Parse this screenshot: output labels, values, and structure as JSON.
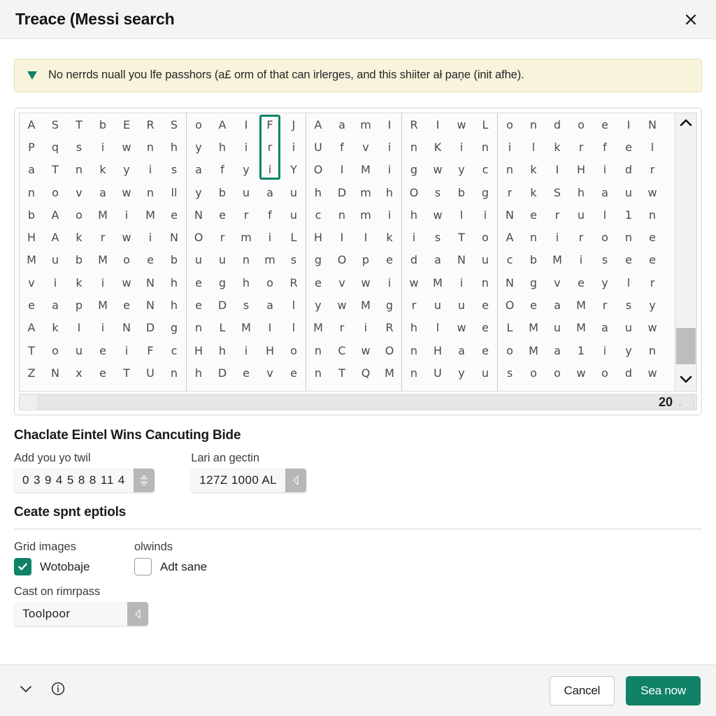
{
  "window": {
    "title": "Treace (Messi search",
    "close_icon": "close-icon"
  },
  "banner": {
    "icon": "triangle-down-icon",
    "accent_color": "#0f8267",
    "background_color": "#f8f4dc",
    "text": "No nerrds nuall you lfe passhors (a£ orm of that can irlerges, and this shiiter ał paņe (init afhe)."
  },
  "grid": {
    "blocks": [
      {
        "columns": 7,
        "rows": [
          [
            "A",
            "S",
            "T",
            "b",
            "E",
            "R",
            "S"
          ],
          [
            "P",
            "q",
            "s",
            "i",
            "w",
            "n",
            "h"
          ],
          [
            "a",
            "T",
            "n",
            "k",
            "y",
            "i",
            "s"
          ],
          [
            "n",
            "o",
            "v",
            "a",
            "w",
            "n",
            "ll"
          ],
          [
            "b",
            "A",
            "o",
            "M",
            "i",
            "M",
            "e"
          ],
          [
            "H",
            "A",
            "k",
            "r",
            "w",
            "i",
            "N"
          ],
          [
            "M",
            "u",
            "b",
            "M",
            "o",
            "e",
            "b"
          ],
          [
            "v",
            "i",
            "k",
            "i",
            "w",
            "N",
            "h"
          ],
          [
            "e",
            "a",
            "p",
            "M",
            "e",
            "N",
            "h"
          ],
          [
            "A",
            "k",
            "I",
            "i",
            "N",
            "D",
            "g"
          ],
          [
            "T",
            "o",
            "u",
            "e",
            "i",
            "F",
            "c"
          ],
          [
            "Z",
            "N",
            "x",
            "e",
            "T",
            "U",
            "n"
          ]
        ]
      },
      {
        "columns": 5,
        "rows": [
          [
            "o",
            "A",
            "I",
            "F",
            "J"
          ],
          [
            "y",
            "h",
            "i",
            "r",
            "i"
          ],
          [
            "a",
            "f",
            "y",
            "i",
            "Y"
          ],
          [
            "y",
            "b",
            "u",
            "a",
            "u"
          ],
          [
            "N",
            "e",
            "r",
            "f",
            "u"
          ],
          [
            "O",
            "r",
            "m",
            "i",
            "L"
          ],
          [
            "u",
            "u",
            "n",
            "m",
            "s"
          ],
          [
            "e",
            "g",
            "h",
            "o",
            "R"
          ],
          [
            "e",
            "D",
            "s",
            "a",
            "l"
          ],
          [
            "n",
            "L",
            "M",
            "I",
            "l"
          ],
          [
            "H",
            "h",
            "i",
            "H",
            "o"
          ],
          [
            "h",
            "D",
            "e",
            "v",
            "e"
          ]
        ]
      },
      {
        "columns": 4,
        "rows": [
          [
            "A",
            "a",
            "m",
            "I"
          ],
          [
            "U",
            "f",
            "v",
            "i"
          ],
          [
            "O",
            "I",
            "M",
            "i"
          ],
          [
            "h",
            "D",
            "m",
            "h"
          ],
          [
            "c",
            "n",
            "m",
            "i"
          ],
          [
            "H",
            "I",
            "I",
            "k"
          ],
          [
            "g",
            "O",
            "p",
            "e"
          ],
          [
            "e",
            "v",
            "w",
            "i"
          ],
          [
            "y",
            "w",
            "M",
            "g"
          ],
          [
            "M",
            "r",
            "i",
            "R"
          ],
          [
            "n",
            "C",
            "w",
            "O"
          ],
          [
            "n",
            "T",
            "Q",
            "M"
          ]
        ]
      },
      {
        "columns": 4,
        "rows": [
          [
            "R",
            "I",
            "w",
            "L"
          ],
          [
            "n",
            "K",
            "i",
            "n"
          ],
          [
            "g",
            "w",
            "y",
            "c"
          ],
          [
            "O",
            "s",
            "b",
            "g"
          ],
          [
            "h",
            "w",
            "l",
            "i"
          ],
          [
            "i",
            "s",
            "T",
            "o"
          ],
          [
            "d",
            "a",
            "N",
            "u"
          ],
          [
            "w",
            "M",
            "i",
            "n"
          ],
          [
            "r",
            "u",
            "u",
            "e"
          ],
          [
            "h",
            "l",
            "w",
            "e"
          ],
          [
            "n",
            "H",
            "a",
            "e"
          ],
          [
            "n",
            "U",
            "y",
            "u"
          ]
        ]
      },
      {
        "columns": 7,
        "rows": [
          [
            "o",
            "n",
            "d",
            "o",
            "e",
            "I",
            "N"
          ],
          [
            "i",
            "l",
            "k",
            "r",
            "f",
            "e",
            "l"
          ],
          [
            "n",
            "k",
            "I",
            "H",
            "i",
            "d",
            "r"
          ],
          [
            "r",
            "k",
            "S",
            "h",
            "a",
            "u",
            "w"
          ],
          [
            "N",
            "e",
            "r",
            "u",
            "l",
            "1",
            "n"
          ],
          [
            "A",
            "n",
            "i",
            "r",
            "o",
            "n",
            "e"
          ],
          [
            "c",
            "b",
            "M",
            "i",
            "s",
            "e",
            "e"
          ],
          [
            "N",
            "g",
            "v",
            "e",
            "y",
            "l",
            "r"
          ],
          [
            "O",
            "e",
            "a",
            "M",
            "r",
            "s",
            "y"
          ],
          [
            "L",
            "M",
            "u",
            "M",
            "a",
            "u",
            "w"
          ],
          [
            "o",
            "M",
            "a",
            "1",
            "i",
            "y",
            "n"
          ],
          [
            "s",
            "o",
            "o",
            "w",
            "o",
            "d",
            "w"
          ]
        ]
      }
    ],
    "highlight": {
      "block_index": 1,
      "column_index": 3,
      "row_start": 0,
      "row_end": 2,
      "color": "#0f8267",
      "letters": [
        "F",
        "r",
        "i"
      ]
    },
    "vertical_scrollbar": {
      "up_icon": "chevron-up-icon",
      "down_icon": "chevron-down-icon"
    },
    "horizontal_scrollbar": {
      "count_label": "20",
      "dot_label": "."
    }
  },
  "settings": {
    "heading": "Chaclate Eintel Wins Cancuting Bide",
    "fields": [
      {
        "label": "Add you yo twil",
        "value": "0 3 9 4 5 8 8 11 4",
        "button_icon": "stepper-updown-icon"
      },
      {
        "label": "Lari an gectin",
        "value": "127Z 1000 AL",
        "button_icon": "caret-left-icon"
      }
    ]
  },
  "options": {
    "heading": "Ceate spnt eptiols",
    "checkbox_groups": [
      {
        "label": "Grid images",
        "checkbox_label": "Wotobaje",
        "checked": true
      },
      {
        "label": "olwinds",
        "checkbox_label": "Adt sane",
        "checked": false
      }
    ],
    "select_field": {
      "label": "Cast on rimrpass",
      "value": "Toolpoor",
      "button_icon": "caret-left-icon"
    }
  },
  "footer": {
    "expand_icon": "chevron-down-icon",
    "info_icon": "info-circle-icon",
    "cancel_label": "Cancel",
    "primary_label": "Sea now",
    "primary_color": "#0f8267"
  }
}
